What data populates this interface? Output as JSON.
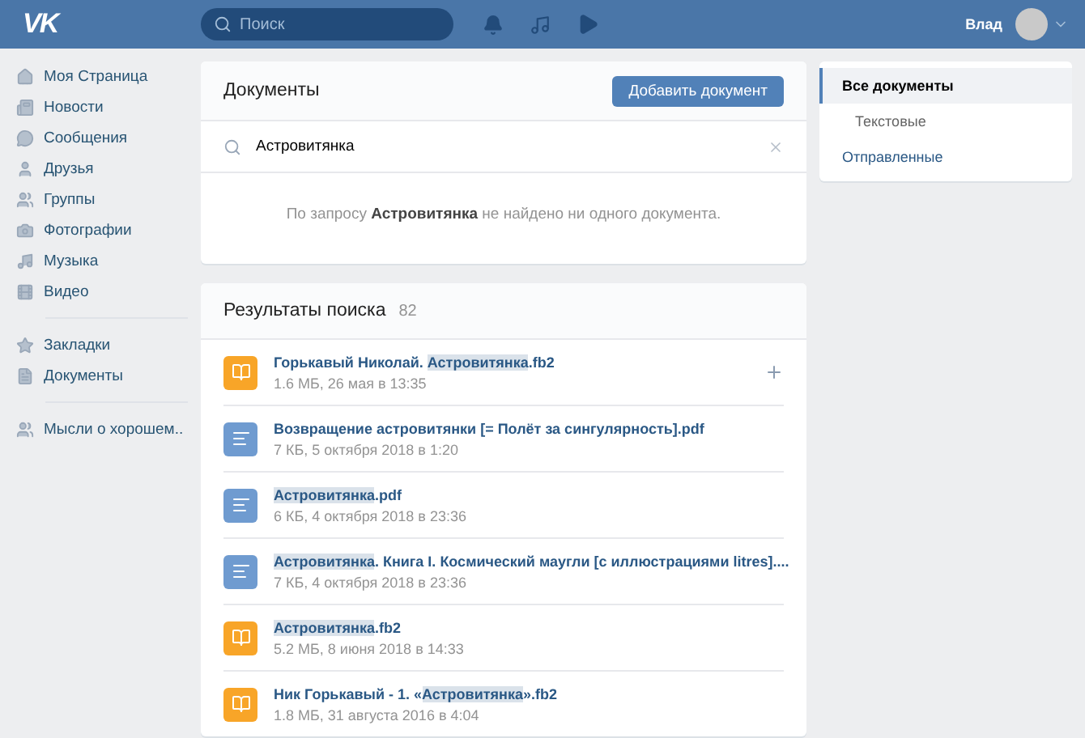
{
  "header": {
    "logo": "VK",
    "search": {
      "placeholder": "Поиск"
    },
    "user": {
      "name": "Влад"
    }
  },
  "sidebar": {
    "sections": [
      [
        {
          "label": "Моя Страница"
        },
        {
          "label": "Новости"
        },
        {
          "label": "Сообщения"
        },
        {
          "label": "Друзья"
        },
        {
          "label": "Группы"
        },
        {
          "label": "Фотографии"
        },
        {
          "label": "Музыка"
        },
        {
          "label": "Видео"
        }
      ],
      [
        {
          "label": "Закладки"
        },
        {
          "label": "Документы"
        }
      ],
      [
        {
          "label": "Мысли о хорошем.."
        }
      ]
    ]
  },
  "documents": {
    "title": "Документы",
    "add_button": "Добавить документ",
    "search": {
      "value": "Астровитянка"
    },
    "message": "По запросу **Астровитянка** не найдено ни одного документа."
  },
  "results": {
    "title": "Результаты поиска",
    "count": "82",
    "rows": [
      {
        "kind": "book",
        "title": [
          {
            "text": "Горькавый Николай. ",
            "highlight": false
          },
          {
            "text": "Астровитянка",
            "highlight": true
          },
          {
            "text": ".fb2",
            "highlight": false
          }
        ],
        "meta": "1.6 МБ, 26 мая в 13:35",
        "add_button": true
      },
      {
        "kind": "text",
        "title": [
          {
            "text": "Возвращение астровитянки [= Полёт за сингулярность].pdf",
            "highlight": false
          }
        ],
        "meta": "7 КБ, 5 октября 2018 в 1:20",
        "add_button": false
      },
      {
        "kind": "text",
        "title": [
          {
            "text": "Астровитянка",
            "highlight": true
          },
          {
            "text": ".pdf",
            "highlight": false
          }
        ],
        "meta": "6 КБ, 4 октября 2018 в 23:36",
        "add_button": false
      },
      {
        "kind": "text",
        "title": [
          {
            "text": "Астровитянка",
            "highlight": true
          },
          {
            "text": ". Книга I. Космический маугли [с иллюстрациями litres]....",
            "highlight": false
          }
        ],
        "meta": "7 КБ, 4 октября 2018 в 23:36",
        "add_button": false
      },
      {
        "kind": "book",
        "title": [
          {
            "text": "Астровитянка",
            "highlight": true
          },
          {
            "text": ".fb2",
            "highlight": false
          }
        ],
        "meta": "5.2 МБ, 8 июня 2018 в 14:33",
        "add_button": false
      },
      {
        "kind": "book",
        "title": [
          {
            "text": "Ник Горькавый - 1. «",
            "highlight": false
          },
          {
            "text": "Астровитянка",
            "highlight": true
          },
          {
            "text": "».fb2",
            "highlight": false
          }
        ],
        "meta": "1.8 МБ, 31 августа 2016 в 4:04",
        "add_button": false
      }
    ]
  },
  "filters": [
    {
      "label": "Все документы",
      "selected": true,
      "children": [
        {
          "label": "Текстовые",
          "selected": false
        }
      ]
    },
    {
      "label": "Отправленные",
      "selected": false
    }
  ]
}
